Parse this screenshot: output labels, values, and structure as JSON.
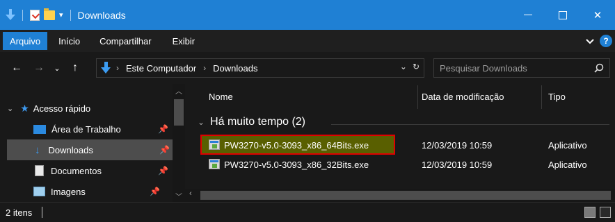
{
  "window": {
    "title": "Downloads",
    "controls": {
      "minimize": "–",
      "maximize": "□",
      "close": "✕"
    }
  },
  "ribbon": {
    "tabs": [
      "Arquivo",
      "Início",
      "Compartilhar",
      "Exibir"
    ],
    "active_tab": "Arquivo",
    "collapse_icon": "chevron-down-icon",
    "help_label": "?"
  },
  "navigation": {
    "breadcrumb": [
      "Este Computador",
      "Downloads"
    ],
    "search_placeholder": "Pesquisar Downloads"
  },
  "sidebar": {
    "items": [
      {
        "label": "Acesso rápido",
        "icon": "star-icon",
        "selected": false,
        "pinned": false
      },
      {
        "label": "Área de Trabalho",
        "icon": "desktop-icon",
        "selected": false,
        "pinned": true
      },
      {
        "label": "Downloads",
        "icon": "download-icon",
        "selected": true,
        "pinned": true
      },
      {
        "label": "Documentos",
        "icon": "document-icon",
        "selected": false,
        "pinned": true
      },
      {
        "label": "Imagens",
        "icon": "image-icon",
        "selected": false,
        "pinned": true
      }
    ]
  },
  "file_list": {
    "columns": [
      "Nome",
      "Data de modificação",
      "Tipo"
    ],
    "group": "Há muito tempo (2)",
    "rows": [
      {
        "name": "PW3270-v5.0-3093_x86_64Bits.exe",
        "date": "12/03/2019 10:59",
        "type": "Aplicativo",
        "highlighted": true
      },
      {
        "name": "PW3270-v5.0-3093_x86_32Bits.exe",
        "date": "12/03/2019 10:59",
        "type": "Aplicativo",
        "highlighted": false
      }
    ]
  },
  "status": {
    "item_count": "2 itens"
  },
  "colors": {
    "titlebar": "#1f80d4",
    "background": "#191919",
    "selection": "#4d4d4d",
    "highlight_fill": "#595f00",
    "highlight_border": "#e00000"
  }
}
